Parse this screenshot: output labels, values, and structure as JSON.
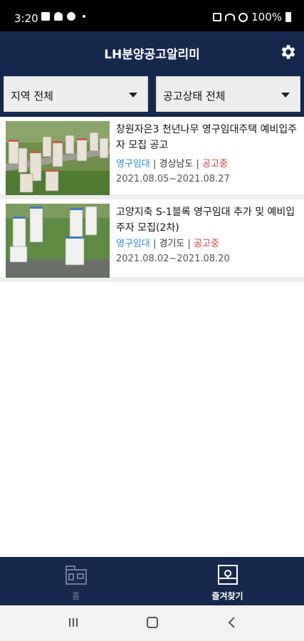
{
  "status_bar": {
    "time": "3:20",
    "battery": "100%"
  },
  "app_bar": {
    "title": "LH분양공고알리미"
  },
  "filters": {
    "region": "지역 전체",
    "status": "공고상태 전체"
  },
  "listings": [
    {
      "title": "창원자은3 천년나무 영구임대주택 예비입주자 모집 공고",
      "type": "영구임대",
      "region": "경상남도",
      "state": "공고중",
      "period": "2021.08.05~2021.08.27"
    },
    {
      "title": "고양지축 S-1블록 영구임대 추가 및 예비입주자 모집(2차)",
      "type": "영구임대",
      "region": "경기도",
      "state": "공고중",
      "period": "2021.08.02~2021.08.20"
    }
  ],
  "meta_separator": "|",
  "bottom_nav": {
    "home_label": "홈",
    "favorites_label": "즐겨찾기"
  },
  "colors": {
    "navy": "#16284e",
    "type_blue": "#2f88d6",
    "state_red": "#d23b3b"
  },
  "icons": [
    "settings-icon",
    "home-icon",
    "favorites-icon",
    "caret-down-icon"
  ]
}
